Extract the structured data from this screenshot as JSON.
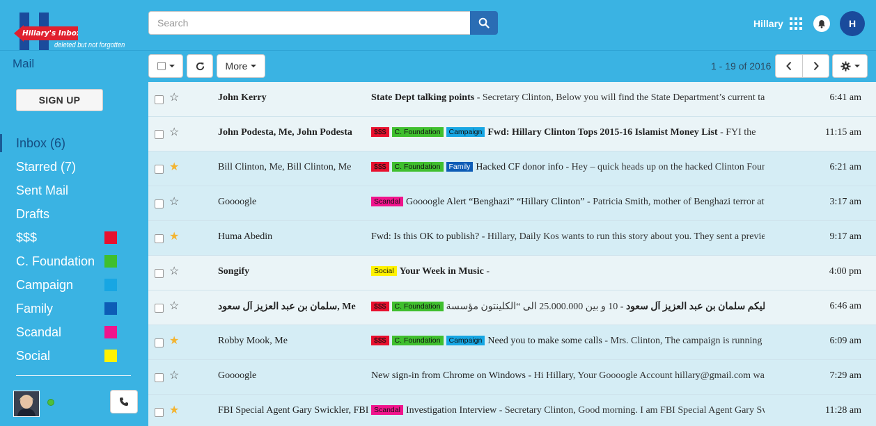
{
  "brand": {
    "logo_banner": "Hillary's Inbox",
    "tagline": "deleted but not forgotten"
  },
  "search": {
    "placeholder": "Search"
  },
  "user": {
    "name": "Hillary",
    "avatar_initial": "H"
  },
  "toolbar": {
    "mail_label": "Mail",
    "more_label": "More",
    "page_info": "1 - 19 of 2016"
  },
  "sidebar": {
    "signup_label": "SIGN UP",
    "items": [
      {
        "label": "Inbox (6)",
        "color": null,
        "active": true
      },
      {
        "label": "Starred (7)",
        "color": null,
        "active": false
      },
      {
        "label": "Sent Mail",
        "color": null,
        "active": false
      },
      {
        "label": "Drafts",
        "color": null,
        "active": false
      },
      {
        "label": "$$$",
        "color": "#e8102e",
        "active": false
      },
      {
        "label": "C. Foundation",
        "color": "#3fbf2e",
        "active": false
      },
      {
        "label": "Campaign",
        "color": "#17a6e3",
        "active": false
      },
      {
        "label": "Family",
        "color": "#0d5cb6",
        "active": false
      },
      {
        "label": "Scandal",
        "color": "#f0148c",
        "active": false
      },
      {
        "label": "Social",
        "color": "#fff200",
        "active": false
      }
    ]
  },
  "tag_colors": {
    "$$$": {
      "bg": "#e8102e",
      "fg": "#111111"
    },
    "C. Foundation": {
      "bg": "#3fbf2e",
      "fg": "#111111"
    },
    "Campaign": {
      "bg": "#17a6e3",
      "fg": "#111111"
    },
    "Family": {
      "bg": "#0d5cb6",
      "fg": "#ffffff"
    },
    "Scandal": {
      "bg": "#f0148c",
      "fg": "#111111"
    },
    "Social": {
      "bg": "#fff200",
      "fg": "#111111"
    }
  },
  "emails": [
    {
      "sender": "John Kerry",
      "starred": false,
      "unread": true,
      "tags": [],
      "subject": "State Dept talking points",
      "snippet": " - Secretary Clinton, Below you will find the State Department’s current talking points",
      "time": "6:41 am"
    },
    {
      "sender": "John Podesta, Me, John Podesta",
      "starred": false,
      "unread": true,
      "tags": [
        "$$$",
        "C. Foundation",
        "Campaign"
      ],
      "subject": "Fwd: Hillary Clinton Tops 2015-16 Islamist Money List",
      "snippet": " - FYI the",
      "time": "11:15 am"
    },
    {
      "sender": "Bill Clinton, Me, Bill Clinton, Me",
      "starred": true,
      "unread": false,
      "tags": [
        "$$$",
        "C. Foundation",
        "Family"
      ],
      "subject": "Hacked CF donor info",
      "snippet": " - Hey – quick heads up on the hacked Clinton Foundation",
      "time": "6:21 am"
    },
    {
      "sender": "Goooogle",
      "starred": false,
      "unread": false,
      "tags": [
        "Scandal"
      ],
      "subject": "Goooogle Alert “Benghazi” “Hillary Clinton”",
      "snippet": " - Patricia Smith, mother of Benghazi terror attack",
      "time": "3:17 am"
    },
    {
      "sender": "Huma Abedin",
      "starred": true,
      "unread": false,
      "tags": [],
      "subject": "Fwd: Is this OK to publish?",
      "snippet": " - Hillary, Daily Kos wants to run this story about you. They sent a preview",
      "time": "9:17 am"
    },
    {
      "sender": "Songify",
      "starred": false,
      "unread": true,
      "tags": [
        "Social"
      ],
      "subject": "Your Week in Music",
      "snippet": " -",
      "time": "4:00 pm"
    },
    {
      "sender": "سلمان بن عبد العزيز آل سعود, Me",
      "starred": false,
      "unread": true,
      "tags": [
        "$$$",
        "C. Foundation"
      ],
      "subject": "ان شاء الله سلام عليكم سلمان بن عبد العزيز آل سعود",
      "snippet": " - 10 و بين 25.000.000 الى “الكلينتون مؤسسة”",
      "time": "6:46 am"
    },
    {
      "sender": "Robby Mook, Me",
      "starred": true,
      "unread": false,
      "tags": [
        "$$$",
        "C. Foundation",
        "Campaign"
      ],
      "subject": "Need you to make some calls",
      "snippet": " - Mrs. Clinton, The campaign is running",
      "time": "6:09 am"
    },
    {
      "sender": "Goooogle",
      "starred": false,
      "unread": false,
      "tags": [],
      "subject": "New sign-in from Chrome on Windows",
      "snippet": " - Hi Hillary, Your Goooogle Account hillary@gmail.com was",
      "time": "7:29 am"
    },
    {
      "sender": "FBI Special Agent Gary Swickler, FBI",
      "starred": true,
      "unread": false,
      "tags": [
        "Scandal"
      ],
      "subject": "Investigation Interview",
      "snippet": " - Secretary Clinton, Good morning. I am FBI Special Agent Gary Swickler",
      "time": "11:28 am"
    }
  ]
}
